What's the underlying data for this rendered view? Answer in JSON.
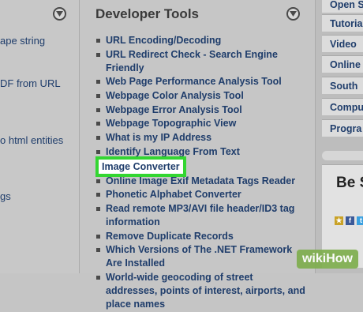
{
  "left": {
    "items": [
      {
        "label": "ape string"
      },
      {
        "label": "DF from URL"
      },
      {
        "label": "o html entities"
      },
      {
        "label": "gs"
      }
    ]
  },
  "main": {
    "title": "Developer Tools",
    "tools": [
      {
        "label": "URL Encoding/Decoding"
      },
      {
        "label": "URL Redirect Check - Search Engine Friendly"
      },
      {
        "label": "Web Page Performance Analysis Tool"
      },
      {
        "label": "Webpage Color Analysis Tool"
      },
      {
        "label": "Webpage Error Analysis Tool"
      },
      {
        "label": "Webpage Topographic View"
      },
      {
        "label": "What is my IP Address"
      },
      {
        "label": "Identify Language From Text"
      },
      {
        "label": "Image Converter"
      },
      {
        "label": "Online Image Exif Metadata Tags Reader"
      },
      {
        "label": "Phonetic Alphabet Converter"
      },
      {
        "label": "Read remote MP3/AVI file header/ID3 tag information"
      },
      {
        "label": "Remove Duplicate Records"
      },
      {
        "label": "Which Versions of The .NET Framework Are Installed"
      },
      {
        "label": "World-wide geocoding of street addresses, points of interest, airports, and place names"
      }
    ]
  },
  "right": {
    "links": [
      {
        "label": "Open S"
      },
      {
        "label": "Tutoria"
      },
      {
        "label": "Video"
      },
      {
        "label": "Online"
      },
      {
        "label": "South"
      },
      {
        "label": "Compu"
      },
      {
        "label": "Progra"
      }
    ],
    "panel_title": "Be S"
  },
  "watermark": {
    "text": "wikiHow"
  },
  "colors": {
    "highlight_border": "#33d631",
    "link": "#1f3d6b"
  }
}
